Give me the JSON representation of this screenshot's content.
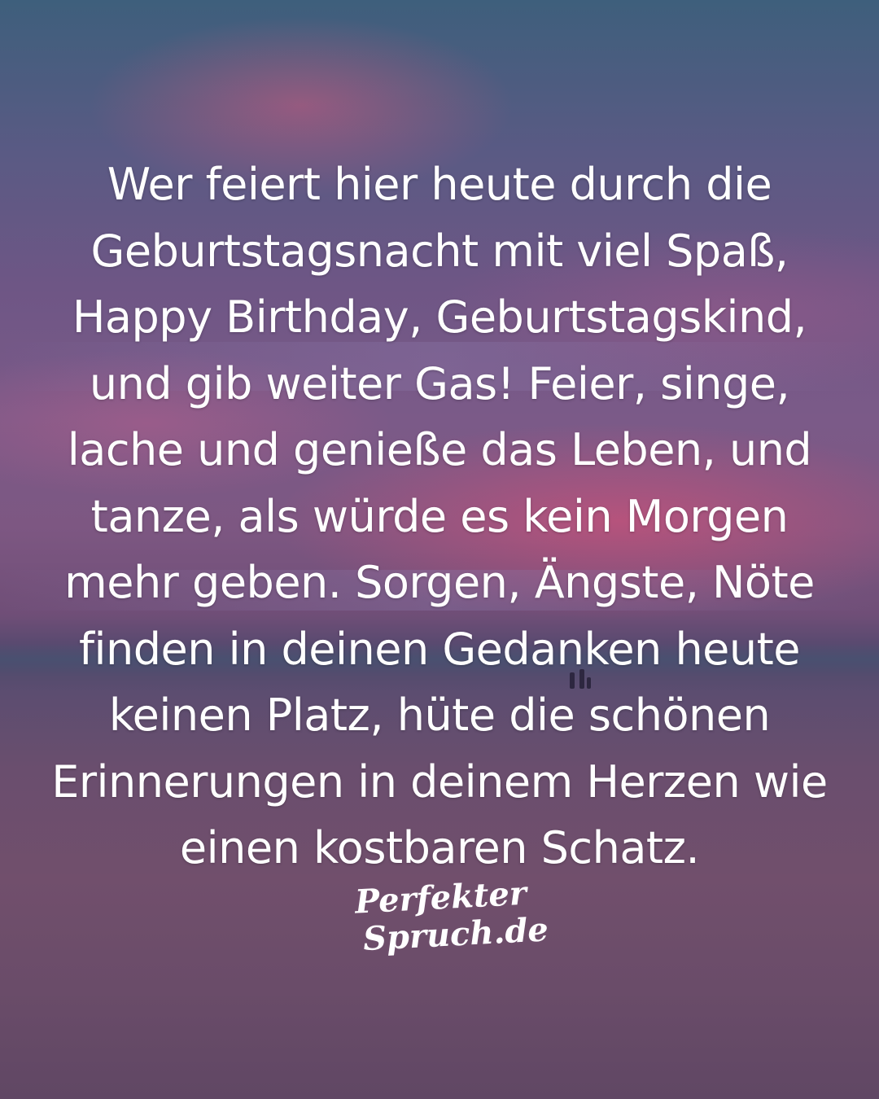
{
  "quote": {
    "lines": [
      "Wer feiert hier heute durch die",
      "Geburtstagsnacht mit viel Spaß,",
      "Happy Birthday, Geburtstagskind,",
      "und gib weiter Gas! Feier, singe,",
      "lache und genieße das Leben, und",
      "tanze, als würde es kein Morgen",
      "mehr geben. Sorgen, Ängste, Nöte",
      "finden in deinen Gedanken heute",
      "keinen Platz, hüte die schönen",
      "Erinnerungen in deinem Herzen wie",
      "einen kostbaren Schatz."
    ]
  },
  "logo": {
    "line1": "Perfekter",
    "line2": "Spruch.de"
  },
  "colors": {
    "text": "#ffffff",
    "sky_top": "#3e5f7c",
    "sky_pink": "#dc5078",
    "beach": "#6a4c69"
  }
}
